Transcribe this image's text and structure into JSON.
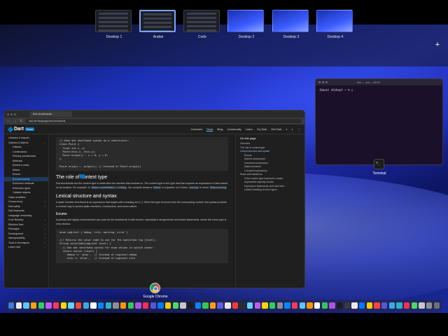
{
  "spaces": [
    {
      "label": "Desktop 1",
      "style": "dark",
      "active": false
    },
    {
      "label": "Arattai",
      "style": "dark",
      "active": true
    },
    {
      "label": "Code",
      "style": "dark",
      "active": false
    },
    {
      "label": "Desktop 2",
      "style": "blue",
      "active": false
    },
    {
      "label": "Desktop 3",
      "style": "blue",
      "active": false
    },
    {
      "label": "Desktop 4",
      "style": "blue",
      "active": false
    }
  ],
  "add_space": "+",
  "terminal": {
    "title": "sbh — -zsh — 80×24",
    "prompt": "(base) shibnyt ~ % ▯",
    "app_label": "Terminal",
    "icon_glyph": ">_"
  },
  "chrome": {
    "app_label": "Google Chrome",
    "tab_title": "Dot shorthands",
    "url": "dart.dev/language/dot-shorthands",
    "nav": {
      "back": "←",
      "forward": "→",
      "reload": "↻"
    }
  },
  "site": {
    "logo_name": "Dart",
    "logo_badge": "Docs",
    "topnav": [
      "Overview",
      "Docs",
      "Blog",
      "Community",
      "Learn",
      "Try Dart",
      "Get Dart"
    ],
    "topnav_active": "Docs"
  },
  "leftnav": [
    {
      "label": "Libraries & imports",
      "sub": false,
      "sel": false
    },
    {
      "label": "Classes & objects",
      "sub": false,
      "sel": false,
      "chev": "⌄"
    },
    {
      "label": "Classes",
      "sub": true,
      "sel": false
    },
    {
      "label": "Constructors",
      "sub": true,
      "sel": false
    },
    {
      "label": "Primary constructors",
      "sub": true,
      "sel": false
    },
    {
      "label": "Methods",
      "sub": true,
      "sel": false
    },
    {
      "label": "Extend a class",
      "sub": true,
      "sel": false
    },
    {
      "label": "Mixins",
      "sub": true,
      "sel": false
    },
    {
      "label": "Enums",
      "sub": true,
      "sel": false
    },
    {
      "label": "Dot shorthands",
      "sub": true,
      "sel": true
    },
    {
      "label": "Extension methods",
      "sub": true,
      "sel": false
    },
    {
      "label": "Extension types",
      "sub": true,
      "sel": false
    },
    {
      "label": "Callable objects",
      "sub": true,
      "sel": false
    },
    {
      "label": "Class modifiers",
      "sub": false,
      "sel": false,
      "chev": "›"
    },
    {
      "label": "Concurrency",
      "sub": false,
      "sel": false,
      "chev": "›"
    },
    {
      "label": "Null safety",
      "sub": false,
      "sel": false,
      "chev": "›"
    },
    {
      "label": "Dart keywords",
      "sub": false,
      "sel": false
    },
    {
      "label": "Language versioning",
      "sub": false,
      "sel": false
    },
    {
      "label": "Core libraries",
      "sub": false,
      "sel": false,
      "chev": "›"
    },
    {
      "label": "Effective Dart",
      "sub": false,
      "sel": false,
      "chev": "›"
    },
    {
      "label": "Packages",
      "sub": false,
      "sel": false,
      "chev": "›"
    },
    {
      "label": "Development",
      "sub": false,
      "sel": false,
      "chev": "›"
    },
    {
      "label": "Interoperability",
      "sub": false,
      "sel": false,
      "chev": "›"
    },
    {
      "label": "Tools & techniques",
      "sub": false,
      "sel": false,
      "chev": "›"
    },
    {
      "label": "Learn Dart",
      "sub": false,
      "sel": false,
      "chev": "›"
    }
  ],
  "content": {
    "code1": [
      "// Uses dot shorthand syntax on a constructor:",
      "class Point {",
      "  final int x, y;",
      "  Point(this.x, this.y);",
      "  Point.origin() : x = 0, y = 0;",
      "}",
      "",
      "Point origin = .origin(); // Instead of Point.origin()"
    ],
    "h_role": "The role of context type",
    "p_role_1": "Dot shorthands use the context type to determine the member that resolves to. The context type is the type that Dart expects an expression to have based on its location. For example, in ",
    "p_role_code1": "Status currentStatus = .running",
    "p_role_2": ", the compiler knows a ",
    "p_role_code2": "Status",
    "p_role_3": " is expected, so it infers ",
    "p_role_code3": ".running",
    "p_role_4": " to mean ",
    "p_role_code4": "Status.running",
    "p_role_5": ".",
    "h_lex": "Lexical structure and syntax",
    "p_lex_1": "A static member shorthand is an expression that begins with a leading dot (",
    "p_lex_code": ".",
    "p_lex_2": "). When the type is known from the surrounding context, this syntax provides a concise way to access static members, constructors, and enum values.",
    "h_enums": "Enums",
    "p_enums": "A primary and highly recommended use-case for dot shorthands is with enums, especially in assignments and switch statements, where the enum type is very obvious.",
    "code2": [
      "enum LogLevel { debug, info, warning, error }",
      "",
      "/// Returns the color code to use for the specified log [level].",
      "String colorCode(LogLevel level) {",
      "  // Use dot shorthand syntax for enum values in switch cases:",
      "  return switch (level) {",
      "    .debug => 'gray',  // Instead of LogLevel.debug",
      "    .info => 'blue',   // Instead of LogLevel.info"
    ]
  },
  "toc": {
    "heading": "On this page",
    "entries": [
      {
        "label": "Overview",
        "sub": false
      },
      {
        "label": "The role of context type",
        "sub": false
      },
      {
        "label": "Lexical structure and syntax",
        "sub": false,
        "active": true
      },
      {
        "label": "Enums",
        "sub": true
      },
      {
        "label": "Named constructors",
        "sub": true
      },
      {
        "label": "Unnamed constructors",
        "sub": true
      },
      {
        "label": "Static members",
        "sub": true
      },
      {
        "label": "Constant expressions",
        "sub": true
      },
      {
        "label": "Rules and limitations",
        "sub": false
      },
      {
        "label": "Clear context type required in chains",
        "sub": true
      },
      {
        "label": "Asymmetric equality checks",
        "sub": true
      },
      {
        "label": "Expression statements can't start with .",
        "sub": true
      },
      {
        "label": "Limited handling of union types",
        "sub": true
      }
    ]
  },
  "dock": {
    "colors": [
      "#3a7bd5",
      "#e8e8e8",
      "#5ac8fa",
      "#ff9f0a",
      "#30d158",
      "#bf5af2",
      "#ff375f",
      "#ffd60a",
      "#64d2ff",
      "#ff453a",
      "#32ade6",
      "#ffffff",
      "#0a84ff",
      "#30b0c7",
      "#8e8e93",
      "#ff9500",
      "#34c759",
      "#af52de",
      "#ff2d55",
      "#5856d6",
      "#007aff",
      "#ffcc00",
      "#4cd964",
      "#c7c7cc",
      "#1c1c1e",
      "#0a84ff",
      "#34c759",
      "#ff9f0a",
      "#5e5ce6",
      "#e5e5ea",
      "#ff3b30",
      "#2c2c2e",
      "#64d2ff",
      "#bf5af2",
      "#ffd60a",
      "#30d158",
      "#8e8e93",
      "#0a84ff",
      "#ff375f",
      "#5ac8fa",
      "#ff9500",
      "#ffffff",
      "#34c759",
      "#af52de",
      "#1c1c1e",
      "#3a3a3c",
      "#e8e8e8",
      "#007aff",
      "#ffcc00",
      "#ff453a",
      "#5856d6",
      "#32ade6",
      "#30b0c7",
      "#ff2d55",
      "#4cd964",
      "#c7c7cc",
      "#8e8e93",
      "#6e6e73"
    ]
  }
}
